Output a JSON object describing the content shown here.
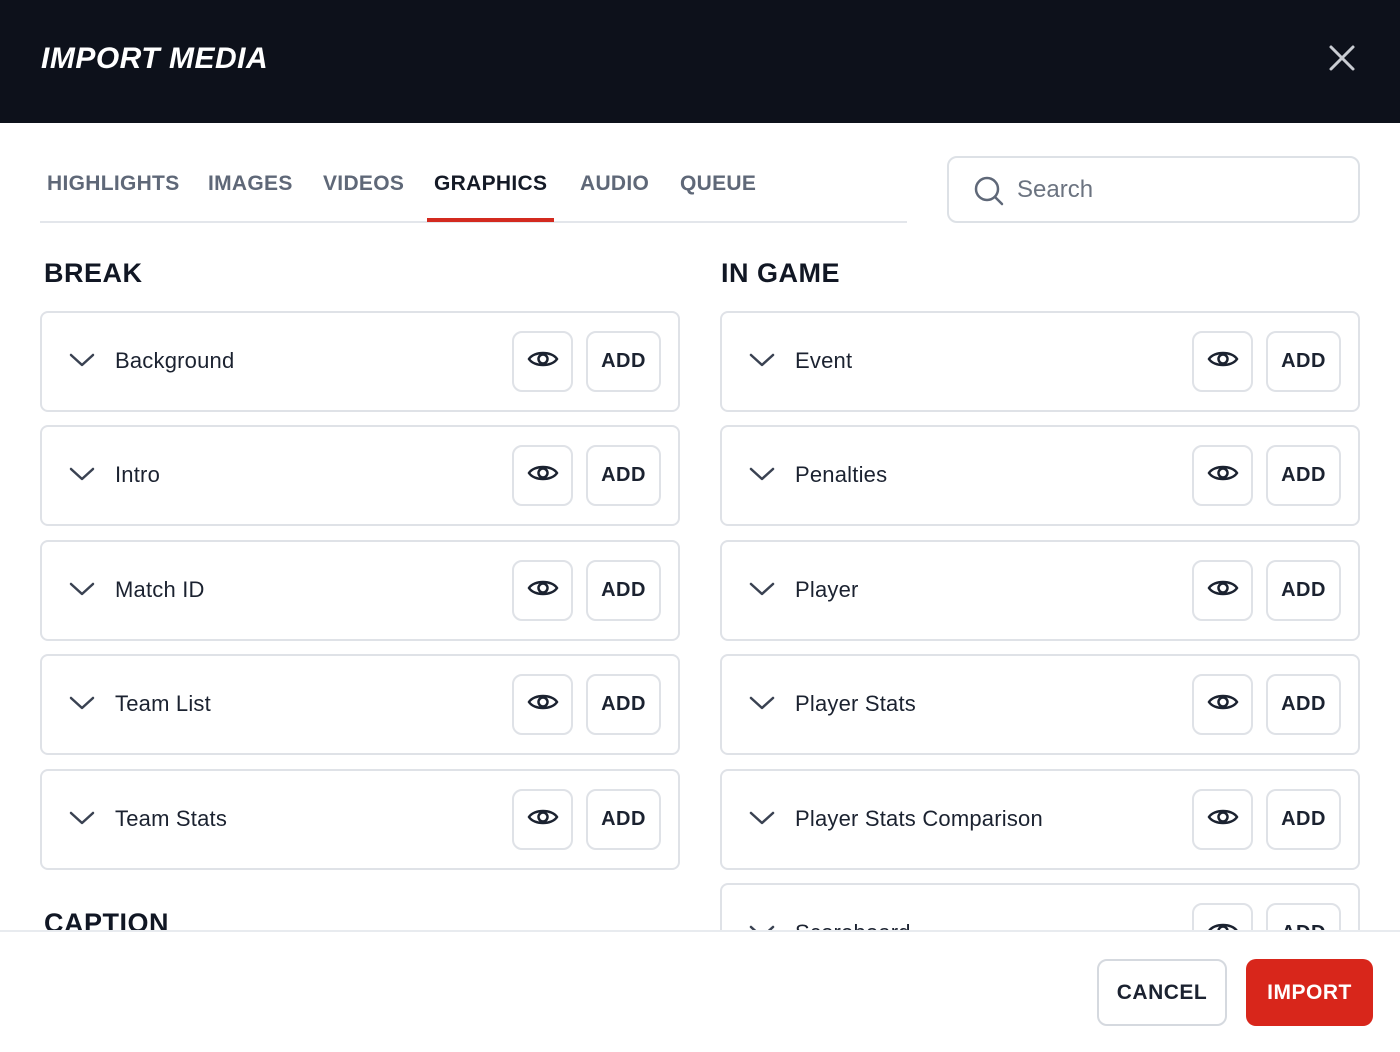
{
  "dialog": {
    "title": "IMPORT MEDIA",
    "close_icon": "close-icon"
  },
  "tabs": [
    {
      "label": "HIGHLIGHTS",
      "active": false
    },
    {
      "label": "IMAGES",
      "active": false
    },
    {
      "label": "VIDEOS",
      "active": false
    },
    {
      "label": "GRAPHICS",
      "active": true
    },
    {
      "label": "AUDIO",
      "active": false
    },
    {
      "label": "QUEUE",
      "active": false
    }
  ],
  "search": {
    "placeholder": "Search",
    "value": "",
    "icon": "search-icon"
  },
  "break": {
    "title": "BREAK",
    "items": [
      {
        "label": "Background",
        "add_label": "ADD"
      },
      {
        "label": "Intro",
        "add_label": "ADD"
      },
      {
        "label": "Match ID",
        "add_label": "ADD"
      },
      {
        "label": "Team List",
        "add_label": "ADD"
      },
      {
        "label": "Team Stats",
        "add_label": "ADD"
      }
    ]
  },
  "caption": {
    "title": "CAPTION"
  },
  "in_game": {
    "title": "IN GAME",
    "items": [
      {
        "label": "Event",
        "add_label": "ADD"
      },
      {
        "label": "Penalties",
        "add_label": "ADD"
      },
      {
        "label": "Player",
        "add_label": "ADD"
      },
      {
        "label": "Player Stats",
        "add_label": "ADD"
      },
      {
        "label": "Player Stats Comparison",
        "add_label": "ADD"
      },
      {
        "label": "Scoreboard",
        "add_label": "ADD"
      }
    ]
  },
  "footer": {
    "cancel_label": "CANCEL",
    "import_label": "IMPORT"
  },
  "colors": {
    "header_bg": "#0d111b",
    "accent": "#d8261b",
    "border": "#dfe2e7"
  }
}
